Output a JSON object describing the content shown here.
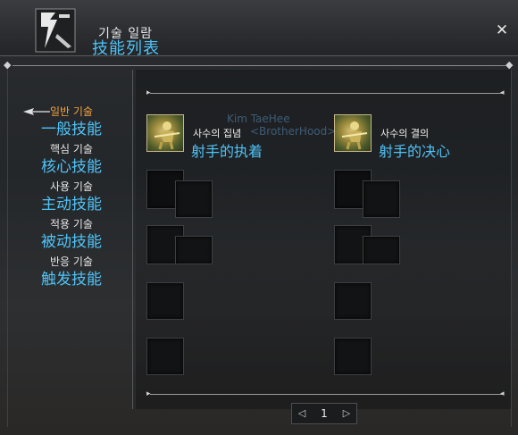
{
  "window": {
    "title_ko": "기술 일람",
    "title_cn": "技能列表",
    "close_icon": "close-icon"
  },
  "sidebar": {
    "items": [
      {
        "ko": "일반 기술",
        "cn": "一般技能",
        "active": true
      },
      {
        "ko": "핵심 기술",
        "cn": "核心技能",
        "active": false
      },
      {
        "ko": "사용 기술",
        "cn": "主动技能",
        "active": false
      },
      {
        "ko": "적용 기술",
        "cn": "被动技能",
        "active": false
      },
      {
        "ko": "반응 기술",
        "cn": "触发技能",
        "active": false
      }
    ]
  },
  "skills": [
    {
      "ko": "사수의 집념",
      "cn": "射手的执着",
      "icon": "archer-skill-icon"
    },
    {
      "ko": "사수의 결의",
      "cn": "射手的决心",
      "icon": "archer-skill-icon"
    }
  ],
  "watermark": {
    "line1": "Kim TaeHee",
    "line2": "<BrotherHood>"
  },
  "pager": {
    "page": "1",
    "prev_icon": "chevron-left-icon",
    "next_icon": "chevron-right-icon"
  },
  "colors": {
    "accent_cn": "#4fc3f7",
    "active_tab": "#f0a040",
    "text": "#e6e6e6"
  }
}
